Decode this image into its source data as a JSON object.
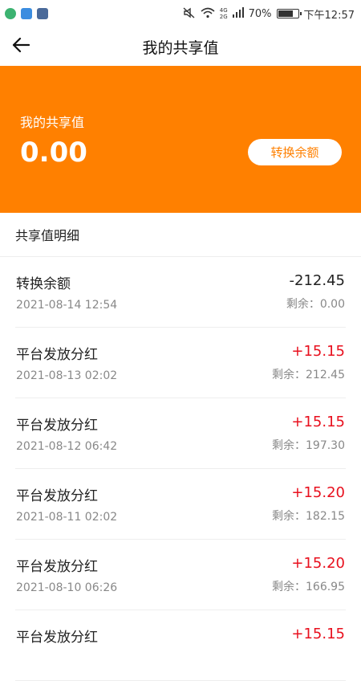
{
  "status_bar": {
    "network_4g": "4G",
    "network_2g": "2G",
    "battery": "70%",
    "battery_level": 0.7,
    "time": "下午12:57"
  },
  "nav": {
    "title": "我的共享值"
  },
  "hero": {
    "label": "我的共享值",
    "value": "0.00",
    "convert_button": "转换余额",
    "bg_color": "#ff8000"
  },
  "section": {
    "title": "共享值明细"
  },
  "records": [
    {
      "title": "转换余额",
      "date": "2021-08-14 12:54",
      "amount": "-212.45",
      "remain": "剩余：0.00"
    },
    {
      "title": "平台发放分红",
      "date": "2021-08-13 02:02",
      "amount": "+15.15",
      "remain": "剩余：212.45"
    },
    {
      "title": "平台发放分红",
      "date": "2021-08-12 06:42",
      "amount": "+15.15",
      "remain": "剩余：197.30"
    },
    {
      "title": "平台发放分红",
      "date": "2021-08-11 02:02",
      "amount": "+15.20",
      "remain": "剩余：182.15"
    },
    {
      "title": "平台发放分红",
      "date": "2021-08-10 06:26",
      "amount": "+15.20",
      "remain": "剩余：166.95"
    },
    {
      "title": "平台发放分红",
      "date": "",
      "amount": "+15.15",
      "remain": ""
    }
  ]
}
